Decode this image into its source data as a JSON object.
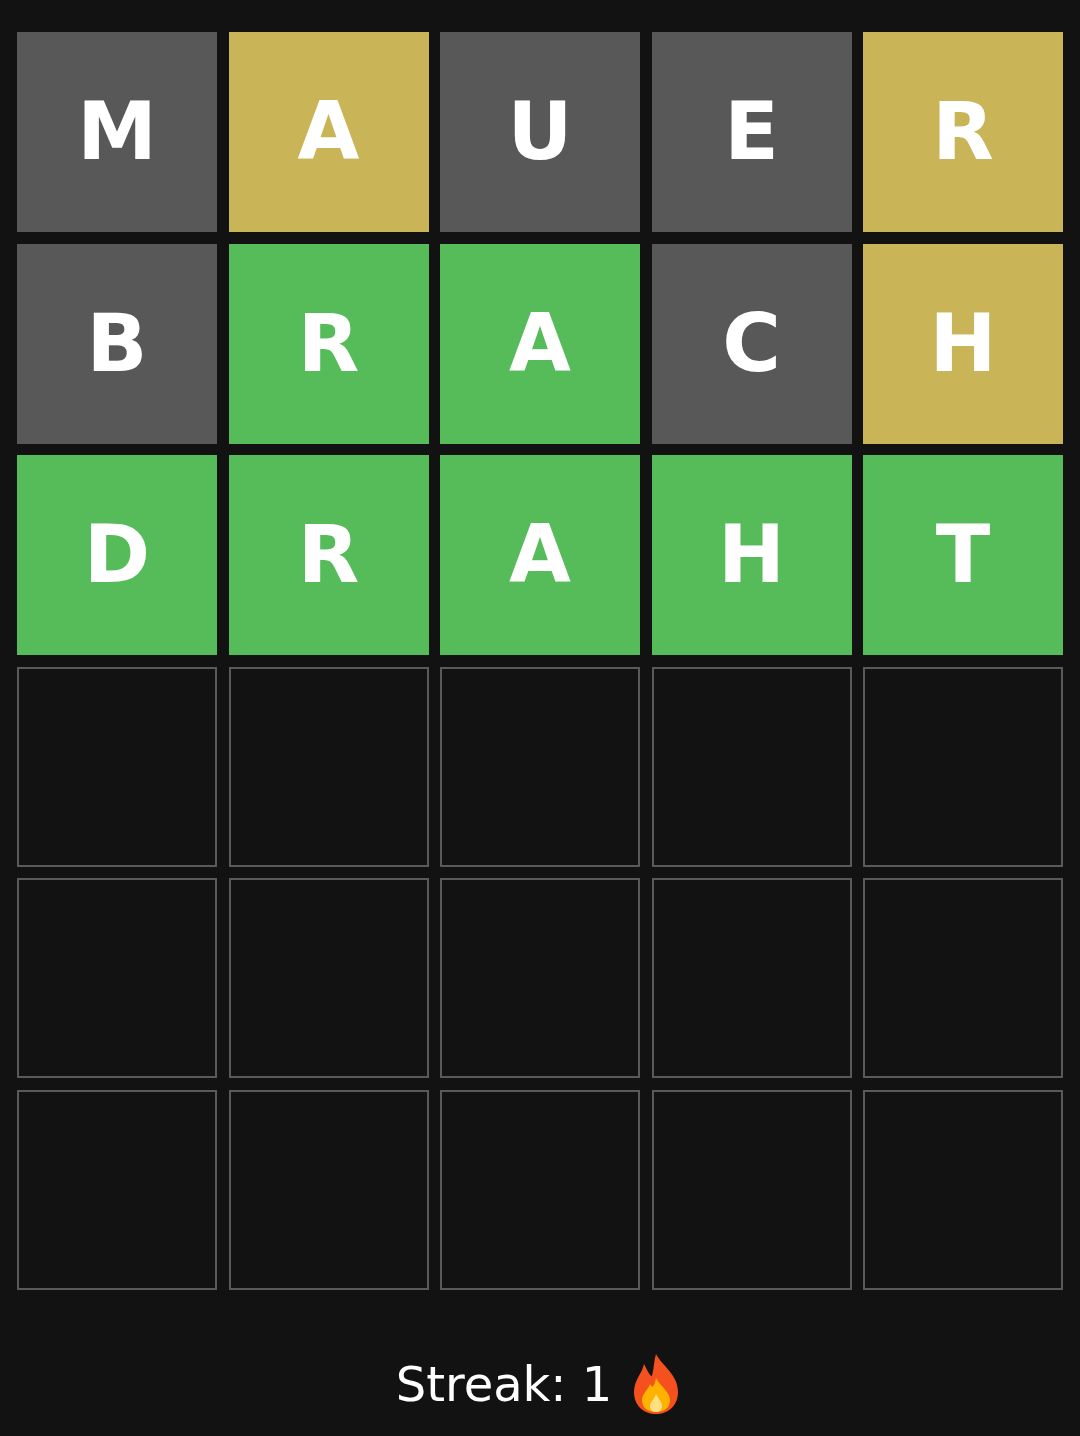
{
  "board": [
    {
      "tiles": [
        {
          "letter": "M",
          "kind": "absent"
        },
        {
          "letter": "A",
          "kind": "present"
        },
        {
          "letter": "U",
          "kind": "absent"
        },
        {
          "letter": "E",
          "kind": "absent"
        },
        {
          "letter": "R",
          "kind": "present"
        }
      ]
    },
    {
      "tiles": [
        {
          "letter": "B",
          "kind": "absent"
        },
        {
          "letter": "R",
          "kind": "correct"
        },
        {
          "letter": "A",
          "kind": "correct"
        },
        {
          "letter": "C",
          "kind": "absent"
        },
        {
          "letter": "H",
          "kind": "present"
        }
      ]
    },
    {
      "tiles": [
        {
          "letter": "D",
          "kind": "correct"
        },
        {
          "letter": "R",
          "kind": "correct"
        },
        {
          "letter": "A",
          "kind": "correct"
        },
        {
          "letter": "H",
          "kind": "correct"
        },
        {
          "letter": "T",
          "kind": "correct"
        }
      ]
    },
    {
      "tiles": [
        {
          "kind": "empty"
        },
        {
          "kind": "empty"
        },
        {
          "kind": "empty"
        },
        {
          "kind": "empty"
        },
        {
          "kind": "empty"
        }
      ]
    },
    {
      "tiles": [
        {
          "kind": "empty"
        },
        {
          "kind": "empty"
        },
        {
          "kind": "empty"
        },
        {
          "kind": "empty"
        },
        {
          "kind": "empty"
        }
      ]
    },
    {
      "tiles": [
        {
          "kind": "empty"
        },
        {
          "kind": "empty"
        },
        {
          "kind": "empty"
        },
        {
          "kind": "empty"
        },
        {
          "kind": "empty"
        }
      ]
    }
  ],
  "streak": {
    "label": "Streak: 1"
  }
}
